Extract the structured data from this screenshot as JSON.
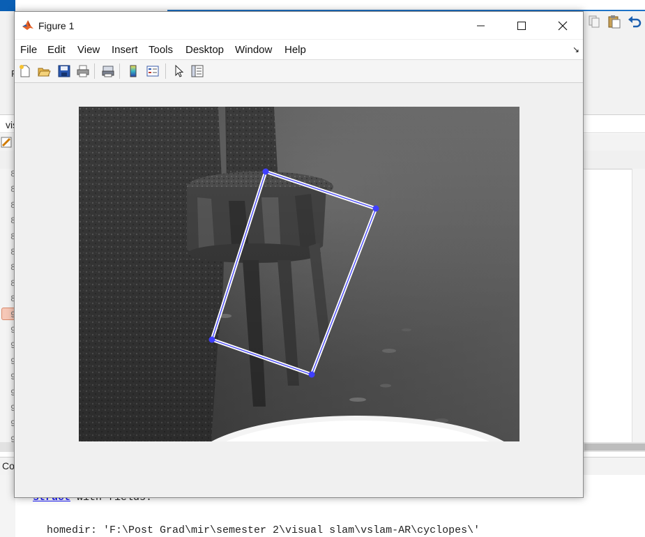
{
  "background": {
    "path_bar_text": "vis",
    "toolstrip_letter": "F",
    "gutter_numbers": [
      "8",
      "8",
      "8",
      "8",
      "8",
      "8",
      "8",
      "8",
      "8",
      "9",
      "9",
      "9",
      "9",
      "9",
      "9",
      "9",
      "9",
      "9"
    ],
    "command_header": "Co",
    "command_line1_kw": "struct",
    "command_line1_rest": " with fields:",
    "command_line2": "homedir: 'F:\\Post Grad\\mir\\semester 2\\visual slam\\vslam-AR\\cyclopes\\'"
  },
  "figure": {
    "title": "Figure 1",
    "menu": [
      "File",
      "Edit",
      "View",
      "Insert",
      "Tools",
      "Desktop",
      "Window",
      "Help"
    ],
    "dock_arrow": "↘",
    "toolbar_icons": [
      "new-figure-icon",
      "open-icon",
      "save-icon",
      "print-icon",
      "print-preview-icon",
      "colorbar-icon",
      "legend-icon",
      "pointer-icon",
      "property-editor-icon"
    ],
    "window_buttons": [
      "minimize-icon",
      "maximize-icon",
      "close-icon"
    ]
  },
  "overlay": {
    "marker_color": "#3f3fff",
    "line_color": "#4a4aff"
  }
}
